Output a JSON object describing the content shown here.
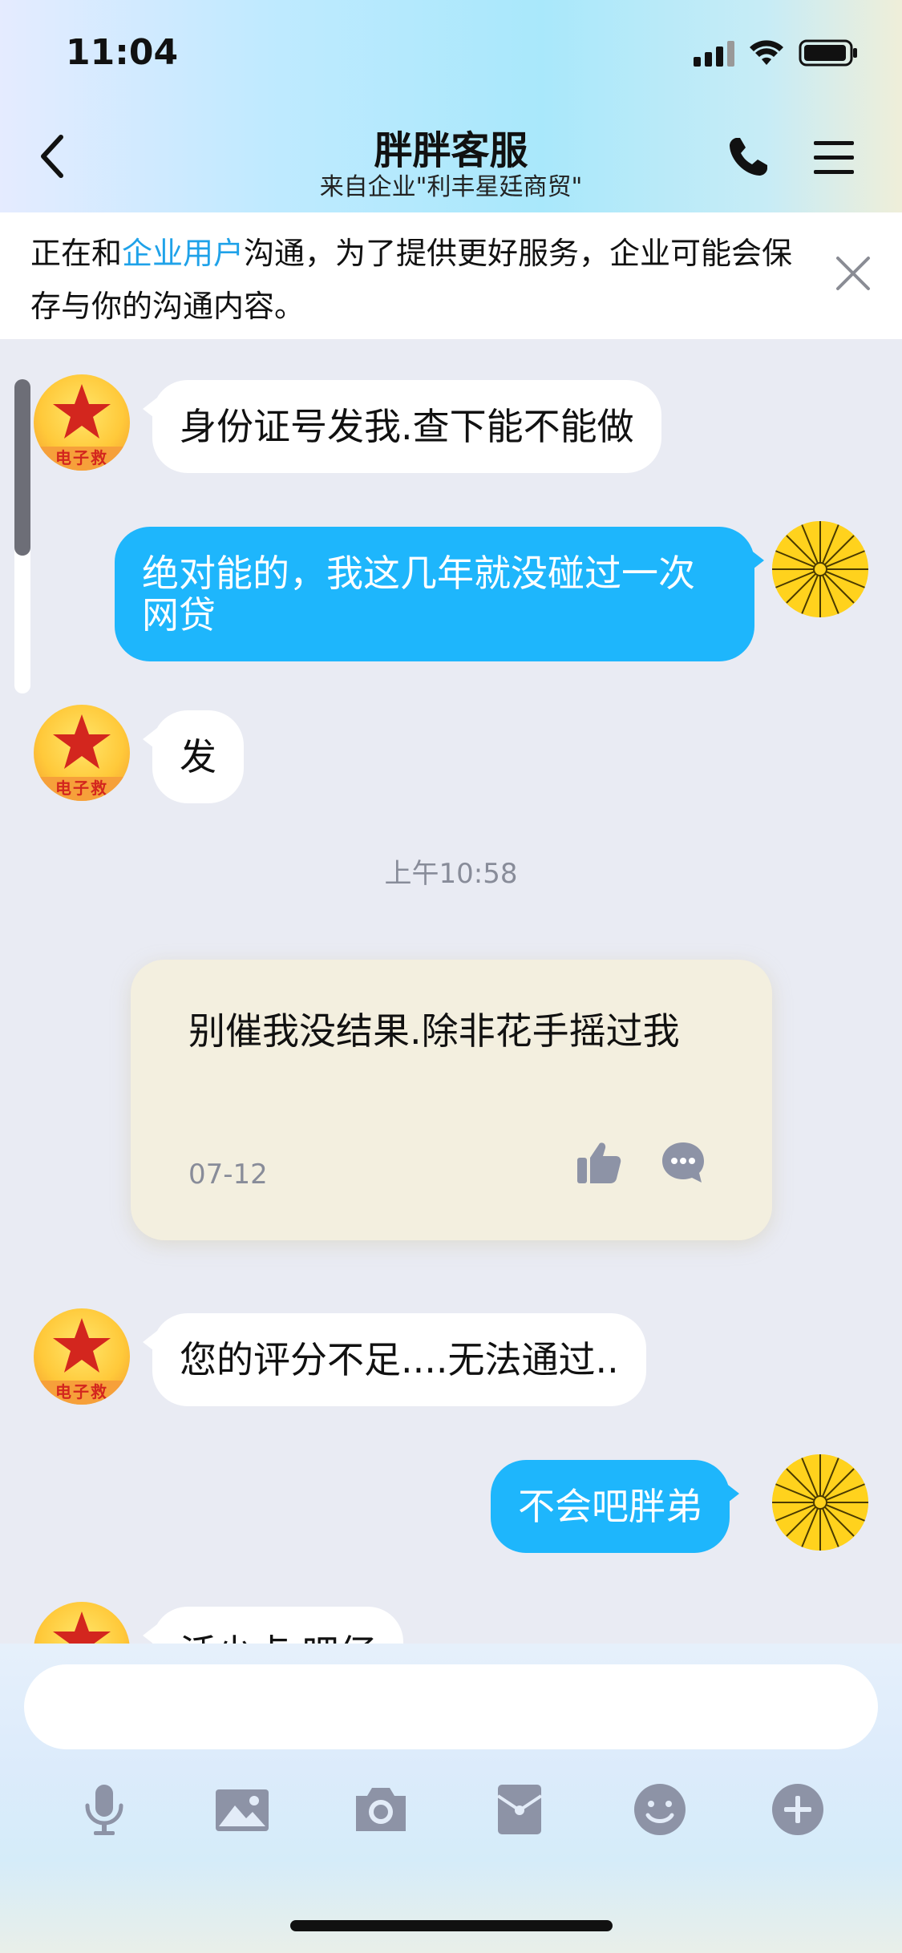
{
  "status_bar": {
    "time": "11:04"
  },
  "header": {
    "title": "胖胖客服",
    "subtitle": "来自企业\"利丰星廷商贸\""
  },
  "notice": {
    "text_before": "正在和",
    "highlight": "企业用户",
    "text_after": "沟通，为了提供更好服务，企业可能会保存与你的沟通内容。"
  },
  "avatar_banner_text": "电子救",
  "messages": [
    {
      "side": "in",
      "text": "身份证号发我.查下能不能做"
    },
    {
      "side": "out",
      "text": "绝对能的，我这几年就没碰过一次网贷"
    },
    {
      "side": "in",
      "text": "发"
    },
    {
      "side": "time",
      "text": "上午10:58"
    },
    {
      "side": "note",
      "text": "别催我没结果.除非花手摇过我",
      "date": "07-12"
    },
    {
      "side": "in",
      "text": "您的评分不足....无法通过.."
    },
    {
      "side": "out",
      "text": "不会吧胖弟"
    },
    {
      "side": "in",
      "text": "活少点.吧仔"
    }
  ],
  "toolbar": {
    "icons": [
      "microphone-icon",
      "image-icon",
      "camera-icon",
      "red-envelope-icon",
      "emoji-icon",
      "plus-icon"
    ]
  },
  "colors": {
    "accent": "#1eb6fc",
    "highlight": "#1fa2e9",
    "background": "#e9ebf3"
  }
}
